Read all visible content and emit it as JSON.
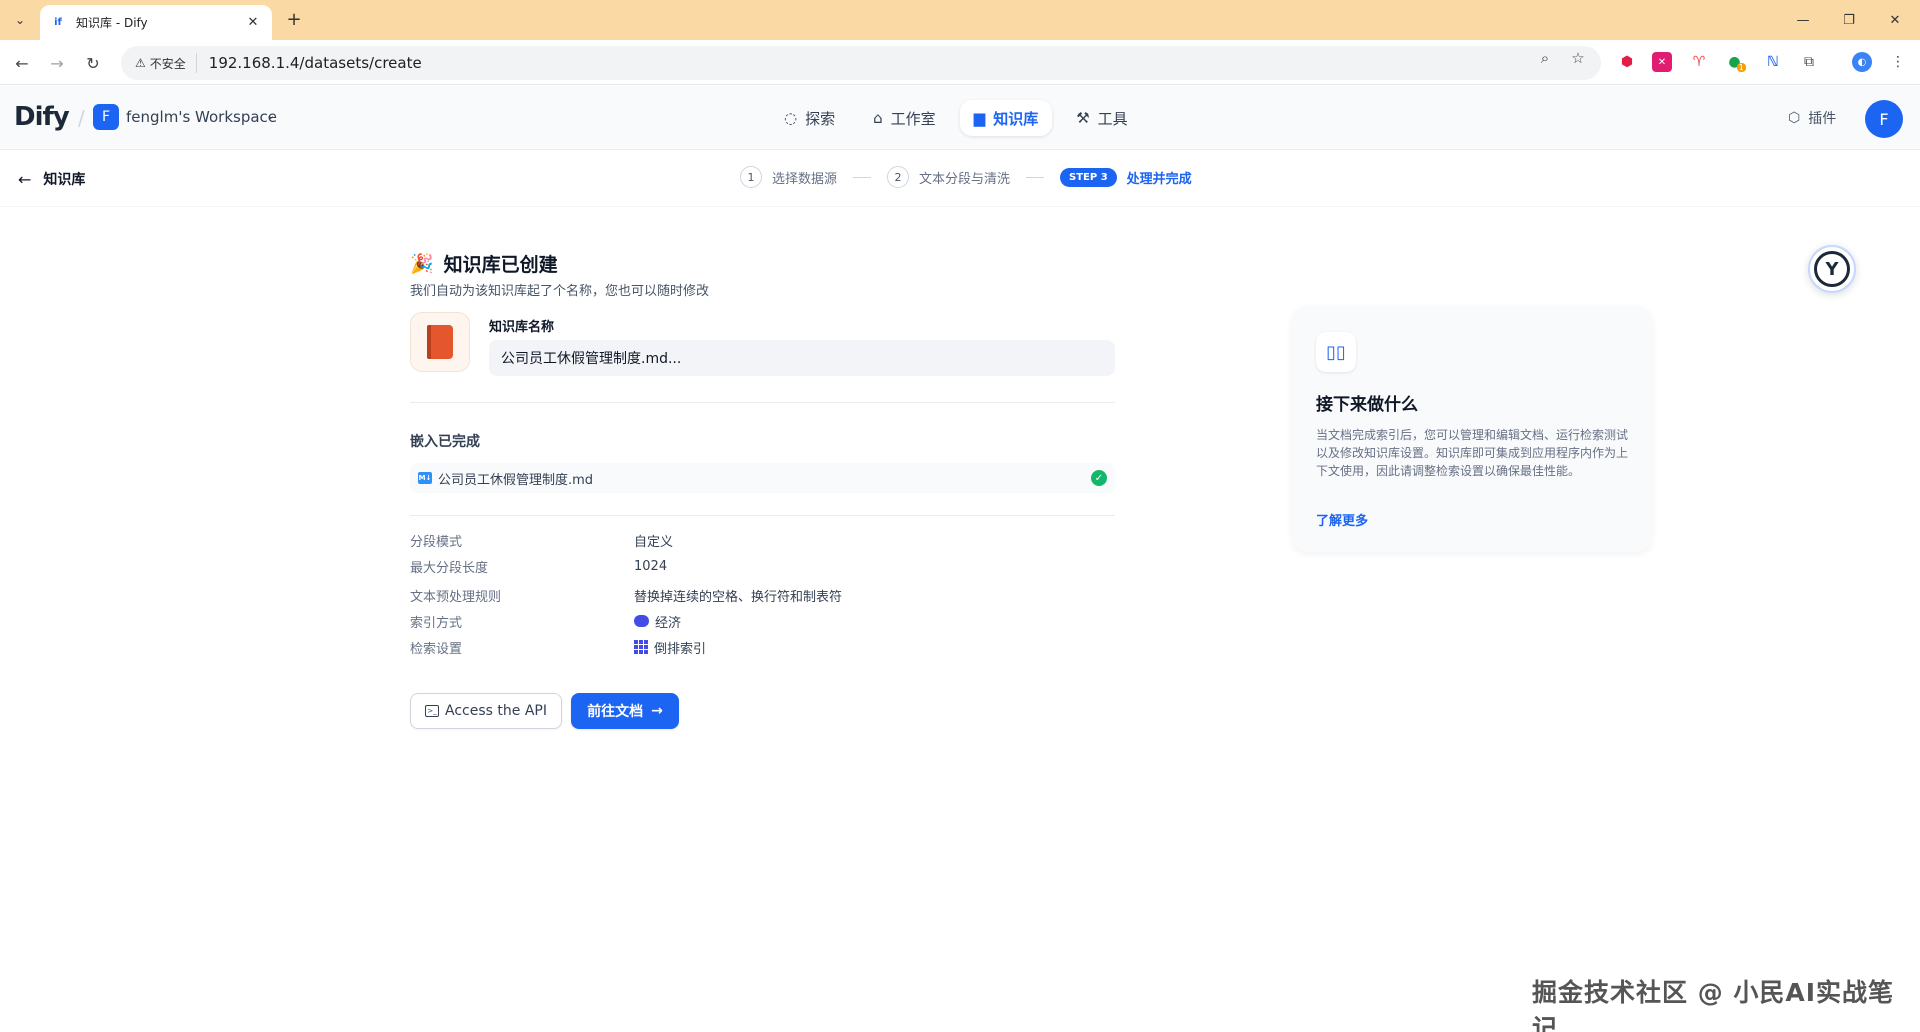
{
  "browser": {
    "tab_title": "知识库 - Dify",
    "favicon_text": "if",
    "security_label": "不安全",
    "url": "192.168.1.4/datasets/create",
    "extension_badge": "1"
  },
  "header": {
    "logo": "Dify",
    "workspace_initial": "F",
    "workspace_name": "fenglm's Workspace",
    "nav": [
      {
        "label": "探索",
        "icon": "explore-icon"
      },
      {
        "label": "工作室",
        "icon": "robot-icon"
      },
      {
        "label": "知识库",
        "icon": "book-icon"
      },
      {
        "label": "工具",
        "icon": "hammer-icon"
      }
    ],
    "plugin_label": "插件",
    "user_initial": "F"
  },
  "stepbar": {
    "back_label": "知识库",
    "step1_num": "1",
    "step1_label": "选择数据源",
    "step2_num": "2",
    "step2_label": "文本分段与清洗",
    "step3_badge": "STEP 3",
    "step3_label": "处理并完成"
  },
  "main": {
    "title_emoji": "🎉",
    "title": "知识库已创建",
    "subtitle": "我们自动为该知识库起了个名称，您也可以随时修改",
    "name_label": "知识库名称",
    "name_value": "公司员工休假管理制度.md...",
    "embed_title": "嵌入已完成",
    "file_type": "M↓",
    "file_name": "公司员工休假管理制度.md",
    "props": [
      {
        "key": "分段模式",
        "value": "自定义"
      },
      {
        "key": "最大分段长度",
        "value": "1024"
      },
      {
        "key": "文本预处理规则",
        "value": "替换掉连续的空格、换行符和制表符"
      },
      {
        "key": "索引方式",
        "value": "经济"
      },
      {
        "key": "检索设置",
        "value": "倒排索引"
      }
    ],
    "api_button": "Access the API",
    "go_button": "前往文档"
  },
  "card": {
    "title": "接下来做什么",
    "desc": "当文档完成索引后，您可以管理和编辑文档、运行检索测试以及修改知识库设置。知识库即可集成到应用程序内作为上下文使用，因此请调整检索设置以确保最佳性能。",
    "link": "了解更多"
  },
  "watermark": "掘金技术社区 @ 小民AI实战笔记",
  "colors": {
    "accent": "#1c64f2",
    "success": "#12b76a",
    "tabstrip": "#fad9a5"
  }
}
